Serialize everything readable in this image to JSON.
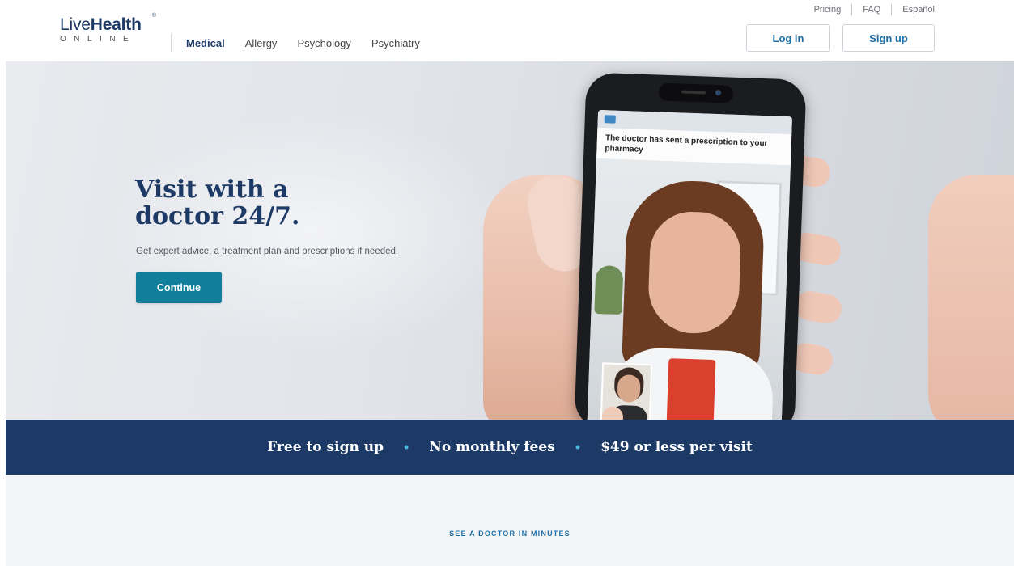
{
  "brand": {
    "name_light": "Live",
    "name_bold": "Health",
    "registered": "®",
    "sub": "ONLINE"
  },
  "nav": {
    "items": [
      {
        "label": "Medical",
        "active": true
      },
      {
        "label": "Allergy",
        "active": false
      },
      {
        "label": "Psychology",
        "active": false
      },
      {
        "label": "Psychiatry",
        "active": false
      }
    ]
  },
  "utility_nav": {
    "pricing": "Pricing",
    "faq": "FAQ",
    "espanol": "Español"
  },
  "auth": {
    "login_label": "Log in",
    "signup_label": "Sign up"
  },
  "hero": {
    "title_line1": "Visit with a",
    "title_line2": "doctor 24/7.",
    "subtitle": "Get expert advice, a treatment plan and prescriptions if needed.",
    "cta_label": "Continue",
    "phone_message": "The doctor has sent a prescription to your pharmacy"
  },
  "benefits": {
    "items": [
      "Free to sign up",
      "No monthly fees",
      "$49 or less per visit"
    ],
    "separator": "•"
  },
  "section": {
    "eyebrow": "SEE A DOCTOR IN MINUTES"
  },
  "colors": {
    "navy": "#1d3a66",
    "teal_button": "#117f9c",
    "link_blue": "#1b6fa8",
    "bullet_blue": "#4fb7dd"
  }
}
